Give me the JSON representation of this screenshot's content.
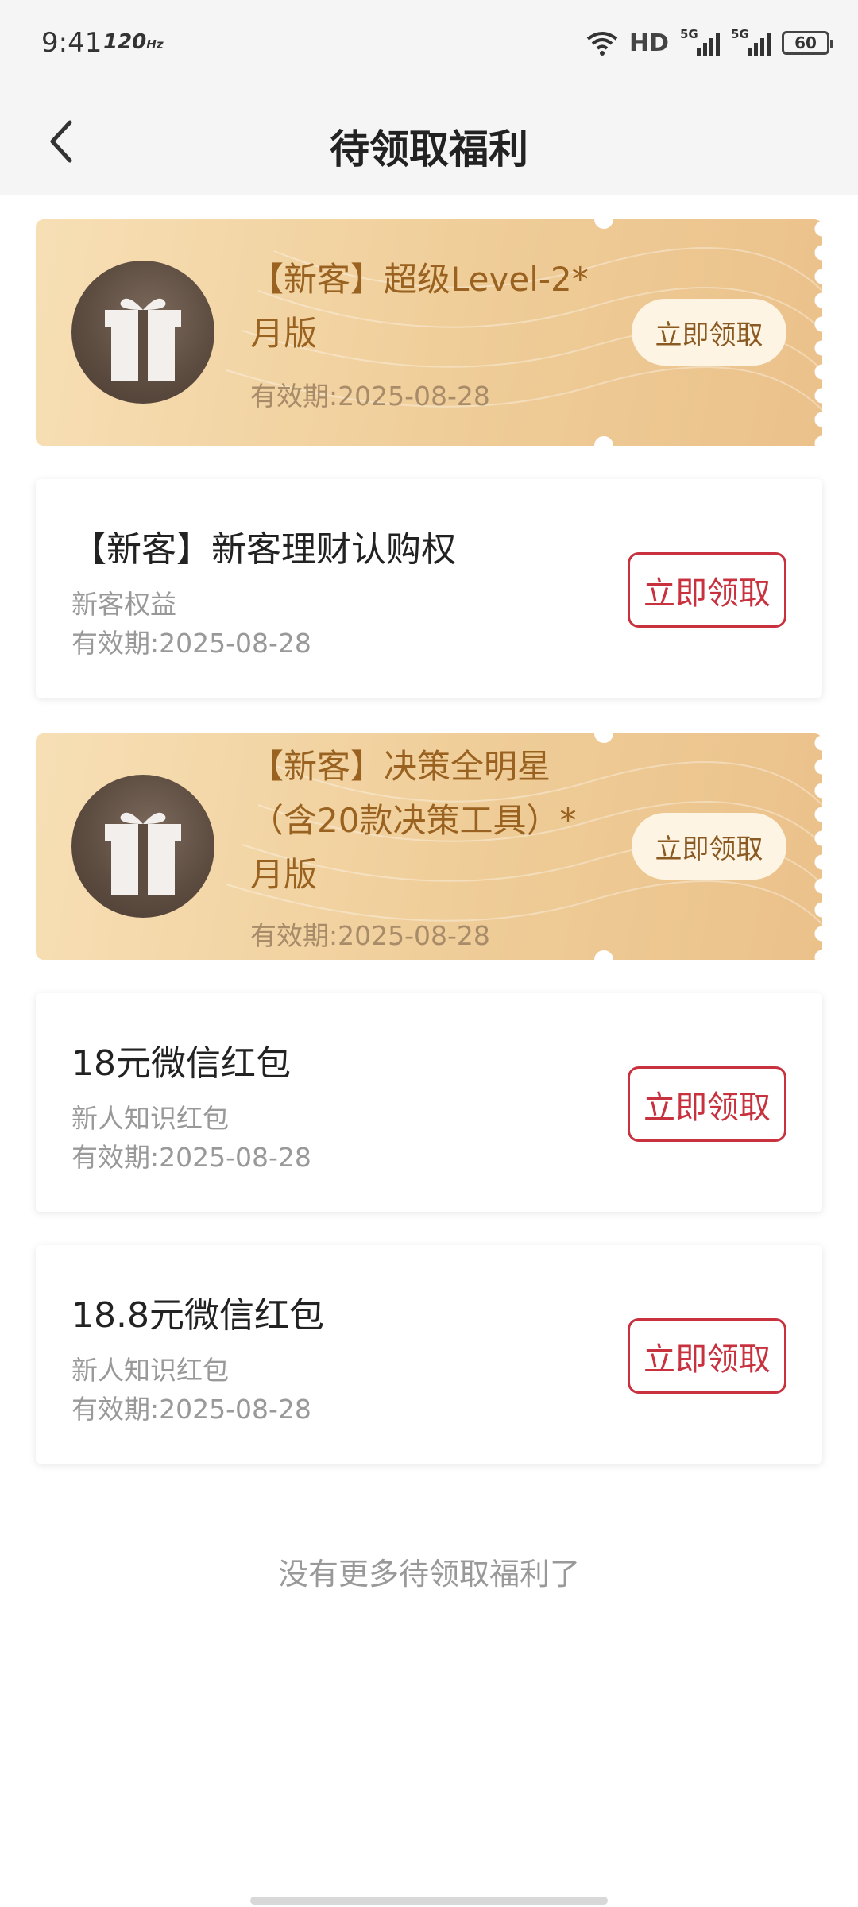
{
  "status_bar": {
    "time": "9:41",
    "refresh_rate": "120",
    "refresh_unit": "Hz",
    "hd": "HD",
    "signal_1": "5G",
    "signal_2": "5G",
    "battery": "60"
  },
  "header": {
    "title": "待领取福利",
    "back_icon": "chevron-left-icon"
  },
  "cards": [
    {
      "style": "gold",
      "title": "【新客】超级Level-2*月版",
      "valid": "有效期:2025-08-28",
      "button": "立即领取",
      "icon": "gift-icon"
    },
    {
      "style": "white",
      "title": "【新客】新客理财认购权",
      "subtitle": "新客权益",
      "valid": "有效期:2025-08-28",
      "button": "立即领取"
    },
    {
      "style": "gold",
      "title": "【新客】决策全明星（含20款决策工具）*月版",
      "valid": "有效期:2025-08-28",
      "button": "立即领取",
      "icon": "gift-icon"
    },
    {
      "style": "white",
      "title": "18元微信红包",
      "subtitle": "新人知识红包",
      "valid": "有效期:2025-08-28",
      "button": "立即领取"
    },
    {
      "style": "white",
      "title": "18.8元微信红包",
      "subtitle": "新人知识红包",
      "valid": "有效期:2025-08-28",
      "button": "立即领取"
    }
  ],
  "footer": {
    "no_more": "没有更多待领取福利了"
  },
  "colors": {
    "accent_red": "#c8323f",
    "gold_text": "#9a6220",
    "gold_bg": "#efcd98"
  }
}
